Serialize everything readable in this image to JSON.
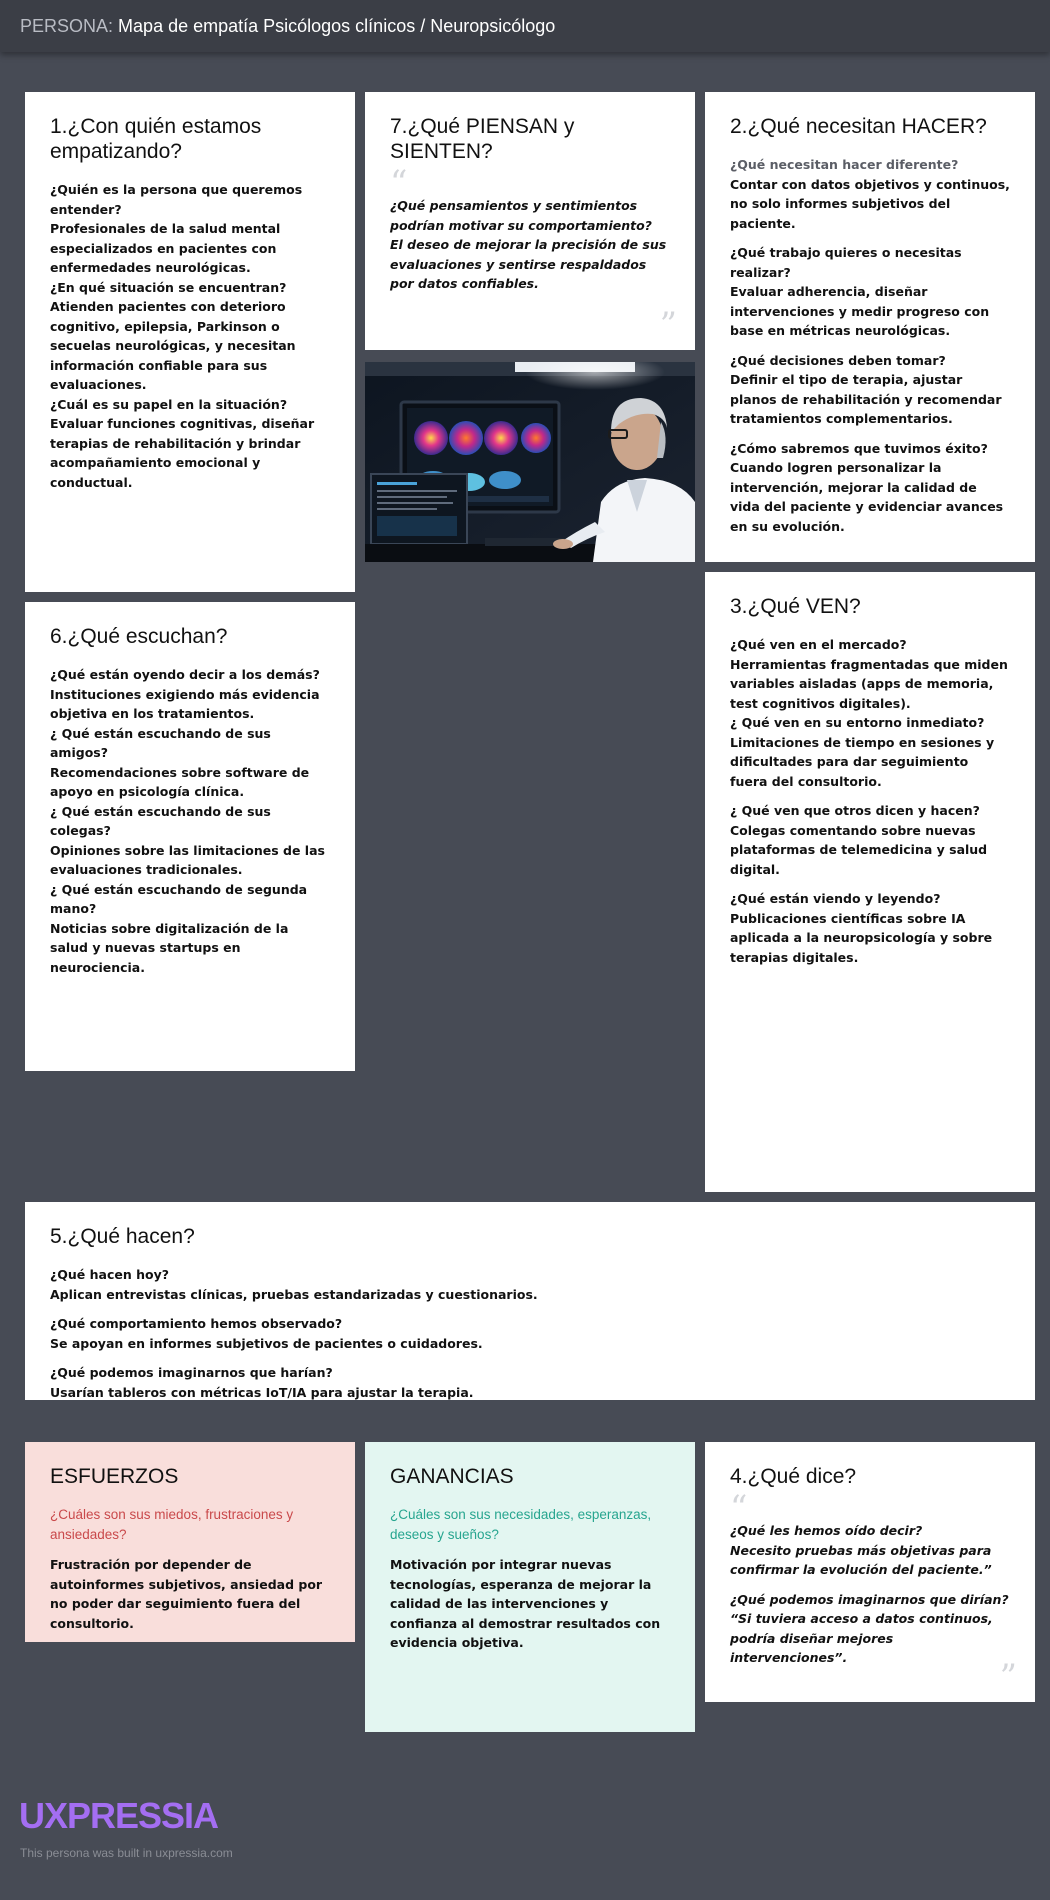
{
  "header": {
    "prefix": "PERSONA:",
    "title": "Mapa de empatía Psicólogos clínicos / Neuropsicólogo"
  },
  "card1": {
    "title": "1.¿Con quién estamos empatizando?",
    "lines": [
      "¿Quién es la persona que queremos entender?",
      " Profesionales de la salud mental especializados en pacientes con enfermedades neurológicas.",
      " ¿En qué situación se encuentran?",
      " Atienden pacientes con deterioro cognitivo, epilepsia, Parkinson o secuelas neurológicas, y necesitan información confiable para sus evaluaciones.",
      "¿Cuál es su papel en la situación?",
      "  Evaluar funciones cognitivas, diseñar terapias de rehabilitación y brindar acompañamiento emocional y conductual."
    ]
  },
  "card7": {
    "title": "7.¿Qué PIENSAN y SIENTEN?",
    "question": "¿Qué pensamientos y sentimientos podrían motivar su comportamiento?",
    "answer": " El deseo de mejorar la precisión de sus evaluaciones y sentirse respaldados por datos confiables."
  },
  "card2": {
    "title": "2.¿Qué necesitan HACER?",
    "q1": "¿Qué necesitan hacer diferente?",
    "a1": "Contar con datos objetivos y continuos, no solo informes subjetivos del paciente.",
    "q2": "¿Qué trabajo quieres o necesitas realizar?",
    "a2": "Evaluar adherencia, diseñar intervenciones y medir progreso con base en métricas neurológicas.",
    "q3": "¿Qué decisiones deben tomar?",
    "a3": " Definir el tipo de terapia, ajustar planos de rehabilitación y recomendar tratamientos complementarios.",
    "q4": "¿Cómo sabremos que tuvimos éxito?",
    "a4": "Cuando logren personalizar la intervención, mejorar la calidad de vida del paciente y evidenciar avances en su evolución."
  },
  "card6": {
    "title": "6.¿Qué escuchan?",
    "lines": [
      "¿Qué están oyendo decir a los demás?",
      "Instituciones exigiendo más evidencia objetiva en los tratamientos.",
      "¿ Qué están escuchando de sus amigos?",
      "Recomendaciones sobre software de apoyo en psicología clínica.",
      "¿ Qué están escuchando de sus colegas?",
      "Opiniones sobre las limitaciones de las evaluaciones tradicionales.",
      "¿ Qué están escuchando de segunda mano?",
      "Noticias sobre digitalización de la salud y nuevas startups en neurociencia."
    ]
  },
  "card3": {
    "title": "3.¿Qué VEN?",
    "p1": [
      "¿Qué ven en el mercado?",
      "Herramientas fragmentadas que miden variables aisladas (apps de memoria, test cognitivos digitales).",
      "¿ Qué ven en su entorno inmediato?",
      "Limitaciones  de tiempo en sesiones y dificultades para dar seguimiento fuera del consultorio."
    ],
    "p2": [
      "¿ Qué ven que otros dicen y hacen?",
      " Colegas comentando sobre nuevas plataformas de telemedicina y salud digital."
    ],
    "p3": [
      "¿Qué están viendo y leyendo?",
      "Publicaciones científicas sobre IA aplicada a la neuropsicología y sobre terapias digitales."
    ]
  },
  "card5": {
    "title": "5.¿Qué hacen?",
    "q1": "¿Qué hacen hoy?",
    "a1": " Aplican entrevistas clínicas, pruebas estandarizadas y cuestionarios.",
    "q2": "¿Qué comportamiento hemos observado?",
    "a2": " Se apoyan en informes subjetivos de pacientes o cuidadores.",
    "q3": "¿Qué podemos imaginarnos que harían?",
    "a3": " Usarían tableros con métricas IoT/IA para ajustar la terapia."
  },
  "pains": {
    "title": "ESFUERZOS",
    "prompt": "¿Cuáles son sus miedos, frustraciones y ansiedades?",
    "text": "Frustración por depender de autoinformes subjetivos, ansiedad por no poder dar seguimiento fuera del consultorio."
  },
  "gains": {
    "title": "GANANCIAS",
    "prompt": "¿Cuáles son sus necesidades, esperanzas, deseos y sueños?",
    "text": "Motivación por integrar nuevas tecnologías, esperanza de mejorar la calidad de las intervenciones y confianza al demostrar resultados con evidencia objetiva."
  },
  "card4": {
    "title": "4.¿Qué dice?",
    "q1": "¿Qué les hemos oído decir?",
    "a1": "Necesito pruebas más objetivas para confirmar la evolución del paciente.”",
    "q2": "¿Qué podemos imaginarnos que dirían?",
    "a2": "  “Si tuviera acceso a datos continuos, podría diseñar mejores intervenciones”."
  },
  "footer": {
    "logo": "UXPRESSIA",
    "note": "This persona was built in uxpressia.com"
  },
  "colors": {
    "background": "#474b55",
    "pains_bg": "#f9dedb",
    "gains_bg": "#e3f6f1",
    "logo": "#a46ef2"
  }
}
